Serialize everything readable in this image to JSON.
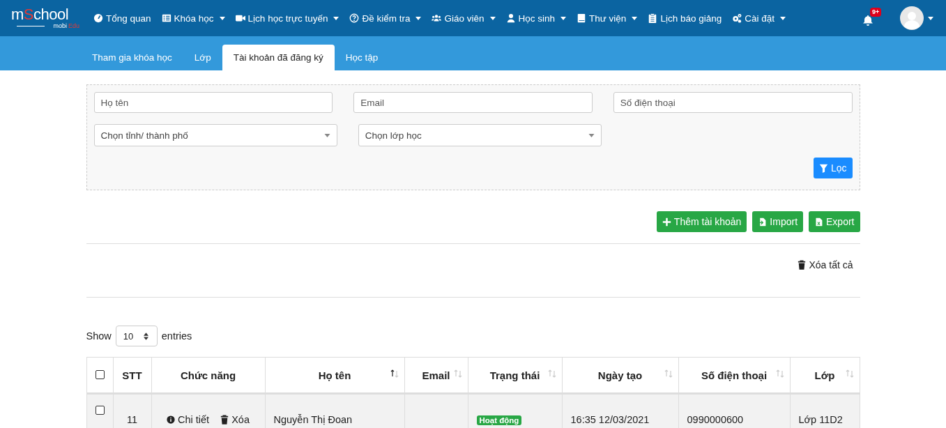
{
  "logo": {
    "main_start": "m",
    "main_accent": "S",
    "main_end": "chool",
    "sub_start": "mobi",
    "sub_accent": "Edu"
  },
  "nav": [
    {
      "label": "Tổng quan",
      "dropdown": false
    },
    {
      "label": "Khóa học",
      "dropdown": true
    },
    {
      "label": "Lịch học trực tuyến",
      "dropdown": true
    },
    {
      "label": "Đề kiểm tra",
      "dropdown": true
    },
    {
      "label": "Giáo viên",
      "dropdown": true
    },
    {
      "label": "Học sinh",
      "dropdown": true
    },
    {
      "label": "Thư viện",
      "dropdown": true
    },
    {
      "label": "Lịch báo giảng",
      "dropdown": false
    },
    {
      "label": "Cài đặt",
      "dropdown": true
    }
  ],
  "notifications": {
    "badge": "9+"
  },
  "tabs": [
    {
      "label": "Tham gia khóa học",
      "selected": false
    },
    {
      "label": "Lớp",
      "selected": false
    },
    {
      "label": "Tài khoản đã đăng ký",
      "selected": true
    },
    {
      "label": "Học tập",
      "selected": false
    }
  ],
  "filters": {
    "name": {
      "placeholder": "Họ tên"
    },
    "email": {
      "placeholder": "Email"
    },
    "phone": {
      "placeholder": "Số điện thoại"
    },
    "province": {
      "placeholder": "Chọn tỉnh/ thành phố"
    },
    "class": {
      "placeholder": "Chọn lớp học"
    },
    "filter_button": "Lọc"
  },
  "actions": [
    "Thêm tài khoản",
    "Import",
    "Export"
  ],
  "delete_all": "Xóa tất cả",
  "length": {
    "show": "Show",
    "value": "10",
    "entries": "entries"
  },
  "table": {
    "header_checked": false,
    "columns": [
      {
        "label": "STT"
      },
      {
        "label": "Chức năng"
      },
      {
        "label": "Họ tên",
        "sorted": true
      },
      {
        "label": "Email",
        "sorted": false
      },
      {
        "label": "Trạng thái",
        "sorted": false
      },
      {
        "label": "Ngày tạo",
        "sorted": false
      },
      {
        "label": "Số điện thoại",
        "sorted": false
      },
      {
        "label": "Lớp",
        "sorted": false
      }
    ],
    "rows": [
      {
        "checked": false,
        "stt": "11",
        "detail": "Chi tiết",
        "delete": "Xóa",
        "name": "Nguyễn Thị Đoan",
        "status": "Hoạt động",
        "created": "16:35 12/03/2021",
        "phone": "0990000600",
        "class": "Lớp 11D2"
      }
    ]
  }
}
